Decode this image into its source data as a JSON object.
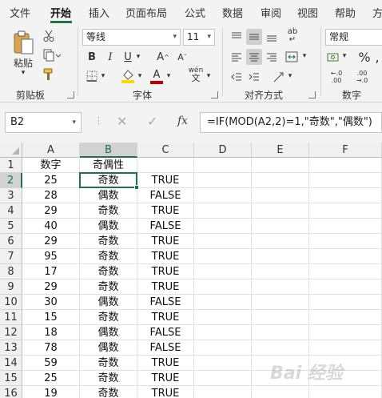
{
  "menu": {
    "items": [
      "文件",
      "开始",
      "插入",
      "页面布局",
      "公式",
      "数据",
      "审阅",
      "视图",
      "帮助",
      "方"
    ],
    "active_index": 1
  },
  "ribbon": {
    "clipboard": {
      "label": "剪贴板",
      "paste_label": "粘贴"
    },
    "font": {
      "label": "字体",
      "font_name": "等线",
      "font_size": "11",
      "bold": "B",
      "italic": "I",
      "underline": "U",
      "grow": "A",
      "shrink": "A",
      "font_color": "A",
      "phonetic": "wén"
    },
    "alignment": {
      "label": "对齐方式",
      "wrap": "ab"
    },
    "number": {
      "label": "数字",
      "format": "常规",
      "percent": "%"
    }
  },
  "formula_bar": {
    "name_box": "B2",
    "fx": "fx",
    "formula": "=IF(MOD(A2,2)=1,\"奇数\",\"偶数\")"
  },
  "sheet": {
    "columns": [
      "A",
      "B",
      "C",
      "D",
      "E",
      "F"
    ],
    "selected_column": "B",
    "selected_row": 2,
    "rows": [
      {
        "n": "1",
        "a": "数字",
        "b": "奇偶性",
        "c": ""
      },
      {
        "n": "2",
        "a": "25",
        "b": "奇数",
        "c": "TRUE"
      },
      {
        "n": "3",
        "a": "28",
        "b": "偶数",
        "c": "FALSE"
      },
      {
        "n": "4",
        "a": "29",
        "b": "奇数",
        "c": "TRUE"
      },
      {
        "n": "5",
        "a": "40",
        "b": "偶数",
        "c": "FALSE"
      },
      {
        "n": "6",
        "a": "29",
        "b": "奇数",
        "c": "TRUE"
      },
      {
        "n": "7",
        "a": "95",
        "b": "奇数",
        "c": "TRUE"
      },
      {
        "n": "8",
        "a": "17",
        "b": "奇数",
        "c": "TRUE"
      },
      {
        "n": "9",
        "a": "29",
        "b": "奇数",
        "c": "TRUE"
      },
      {
        "n": "10",
        "a": "30",
        "b": "偶数",
        "c": "FALSE"
      },
      {
        "n": "11",
        "a": "15",
        "b": "奇数",
        "c": "TRUE"
      },
      {
        "n": "12",
        "a": "18",
        "b": "偶数",
        "c": "FALSE"
      },
      {
        "n": "13",
        "a": "78",
        "b": "偶数",
        "c": "FALSE"
      },
      {
        "n": "14",
        "a": "59",
        "b": "奇数",
        "c": "TRUE"
      },
      {
        "n": "15",
        "a": "25",
        "b": "奇数",
        "c": "TRUE"
      },
      {
        "n": "16",
        "a": "19",
        "b": "奇数",
        "c": "TRUE"
      }
    ]
  },
  "watermark": "Bai 经验",
  "colors": {
    "accent": "#217346",
    "bar": "#f3f3f3",
    "highlight_yellow": "#ffd800",
    "font_red": "#c00000"
  }
}
